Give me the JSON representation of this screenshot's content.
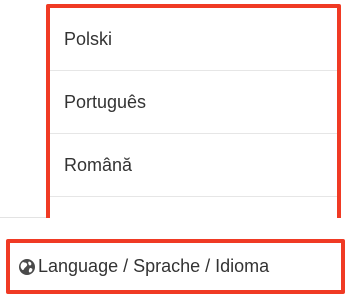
{
  "languages": [
    {
      "label": "Polski"
    },
    {
      "label": "Português"
    },
    {
      "label": "Română"
    }
  ],
  "footer": {
    "language_button_label": "Language / Sprache / Idioma",
    "icon": "globe-icon"
  },
  "colors": {
    "highlight": "#f03a24",
    "text": "#333333",
    "divider": "#e6e6e6"
  }
}
